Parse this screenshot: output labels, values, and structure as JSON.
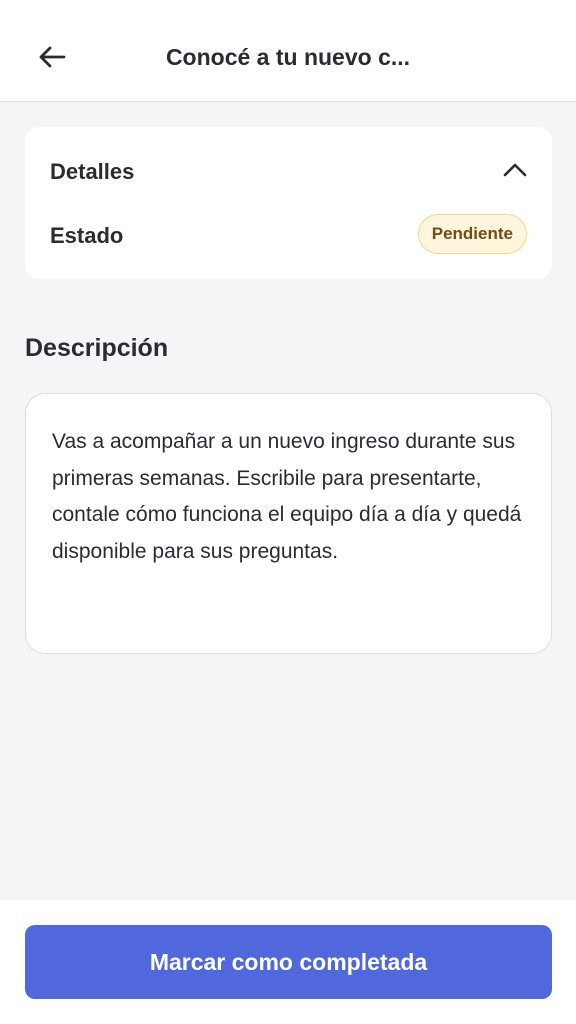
{
  "header": {
    "back_icon": "arrow-left-icon",
    "title": "Conocé a tu nuevo c..."
  },
  "details": {
    "label": "Detalles",
    "toggle_icon": "chevron-up-icon",
    "status_label": "Estado",
    "status_value": "Pendiente",
    "status_colors": {
      "background": "#fdf6dc",
      "border": "#f2d98c",
      "text": "#7a4a12"
    }
  },
  "description": {
    "title": "Descripción",
    "text": "Vas a acompañar a un nuevo ingreso durante sus primeras semanas. Escribile para presentarte, contale cómo funciona el equipo día a día y quedá disponible para sus preguntas."
  },
  "footer": {
    "complete_label": "Marcar como completada"
  },
  "colors": {
    "accent": "#5068dc",
    "background": "#f4f5f7",
    "text": "#2a2c33"
  }
}
